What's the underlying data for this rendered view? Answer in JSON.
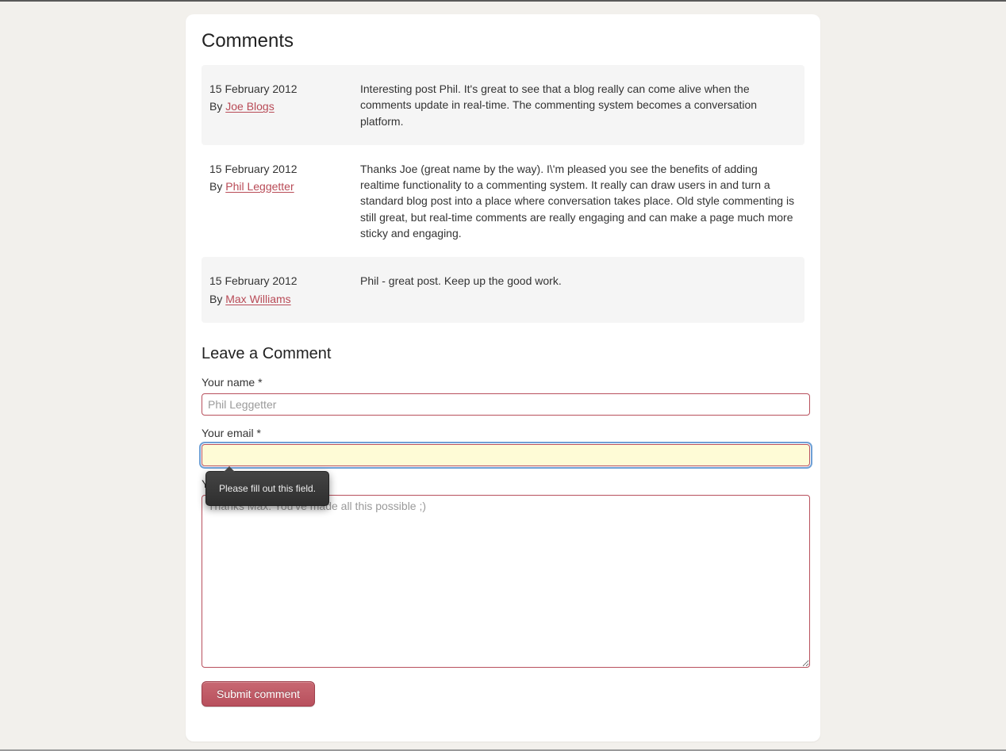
{
  "sections": {
    "comments_title": "Comments",
    "leave_title": "Leave a Comment"
  },
  "comments": [
    {
      "date": "15 February 2012",
      "by_prefix": "By ",
      "author": "Joe Blogs",
      "body": "Interesting post Phil. It's great to see that a blog really can come alive when the comments update in real-time. The commenting system becomes a conversation platform."
    },
    {
      "date": "15 February 2012",
      "by_prefix": "By ",
      "author": "Phil Leggetter",
      "body": "Thanks Joe (great name by the way). I\\'m pleased you see the benefits of adding realtime functionality to a commenting system. It really can draw users in and turn a standard blog post into a place where conversation takes place. Old style commenting is still great, but real-time comments are really engaging and can make a page much more sticky and engaging."
    },
    {
      "date": "15 February 2012",
      "by_prefix": "By ",
      "author": "Max Williams",
      "body": "Phil - great post. Keep up the good work."
    }
  ],
  "form": {
    "name_label": "Your name *",
    "name_placeholder": "Phil Leggetter",
    "name_value": "",
    "email_label": "Your email *",
    "email_value": "",
    "comment_label": "Your comment *",
    "comment_placeholder": "Thanks Max. You've made all this possible ;)",
    "comment_value": "",
    "submit_label": "Submit comment",
    "validation_tooltip": "Please fill out this field."
  }
}
